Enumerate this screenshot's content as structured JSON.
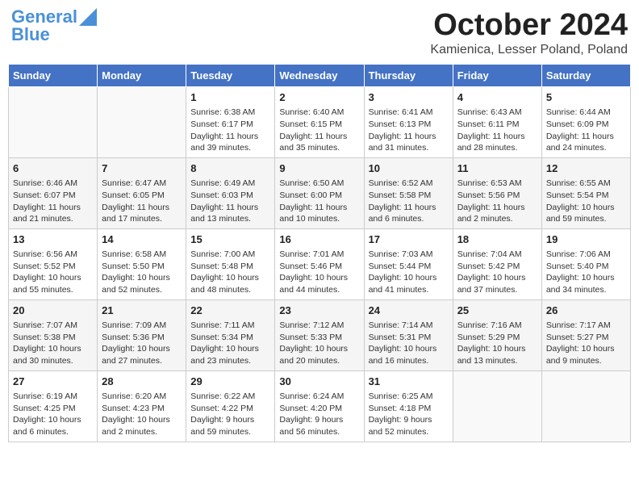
{
  "header": {
    "logo_line1": "General",
    "logo_line2": "Blue",
    "month": "October 2024",
    "location": "Kamienica, Lesser Poland, Poland"
  },
  "days_of_week": [
    "Sunday",
    "Monday",
    "Tuesday",
    "Wednesday",
    "Thursday",
    "Friday",
    "Saturday"
  ],
  "weeks": [
    [
      {
        "day": "",
        "detail": ""
      },
      {
        "day": "",
        "detail": ""
      },
      {
        "day": "1",
        "detail": "Sunrise: 6:38 AM\nSunset: 6:17 PM\nDaylight: 11 hours and 39 minutes."
      },
      {
        "day": "2",
        "detail": "Sunrise: 6:40 AM\nSunset: 6:15 PM\nDaylight: 11 hours and 35 minutes."
      },
      {
        "day": "3",
        "detail": "Sunrise: 6:41 AM\nSunset: 6:13 PM\nDaylight: 11 hours and 31 minutes."
      },
      {
        "day": "4",
        "detail": "Sunrise: 6:43 AM\nSunset: 6:11 PM\nDaylight: 11 hours and 28 minutes."
      },
      {
        "day": "5",
        "detail": "Sunrise: 6:44 AM\nSunset: 6:09 PM\nDaylight: 11 hours and 24 minutes."
      }
    ],
    [
      {
        "day": "6",
        "detail": "Sunrise: 6:46 AM\nSunset: 6:07 PM\nDaylight: 11 hours and 21 minutes."
      },
      {
        "day": "7",
        "detail": "Sunrise: 6:47 AM\nSunset: 6:05 PM\nDaylight: 11 hours and 17 minutes."
      },
      {
        "day": "8",
        "detail": "Sunrise: 6:49 AM\nSunset: 6:03 PM\nDaylight: 11 hours and 13 minutes."
      },
      {
        "day": "9",
        "detail": "Sunrise: 6:50 AM\nSunset: 6:00 PM\nDaylight: 11 hours and 10 minutes."
      },
      {
        "day": "10",
        "detail": "Sunrise: 6:52 AM\nSunset: 5:58 PM\nDaylight: 11 hours and 6 minutes."
      },
      {
        "day": "11",
        "detail": "Sunrise: 6:53 AM\nSunset: 5:56 PM\nDaylight: 11 hours and 2 minutes."
      },
      {
        "day": "12",
        "detail": "Sunrise: 6:55 AM\nSunset: 5:54 PM\nDaylight: 10 hours and 59 minutes."
      }
    ],
    [
      {
        "day": "13",
        "detail": "Sunrise: 6:56 AM\nSunset: 5:52 PM\nDaylight: 10 hours and 55 minutes."
      },
      {
        "day": "14",
        "detail": "Sunrise: 6:58 AM\nSunset: 5:50 PM\nDaylight: 10 hours and 52 minutes."
      },
      {
        "day": "15",
        "detail": "Sunrise: 7:00 AM\nSunset: 5:48 PM\nDaylight: 10 hours and 48 minutes."
      },
      {
        "day": "16",
        "detail": "Sunrise: 7:01 AM\nSunset: 5:46 PM\nDaylight: 10 hours and 44 minutes."
      },
      {
        "day": "17",
        "detail": "Sunrise: 7:03 AM\nSunset: 5:44 PM\nDaylight: 10 hours and 41 minutes."
      },
      {
        "day": "18",
        "detail": "Sunrise: 7:04 AM\nSunset: 5:42 PM\nDaylight: 10 hours and 37 minutes."
      },
      {
        "day": "19",
        "detail": "Sunrise: 7:06 AM\nSunset: 5:40 PM\nDaylight: 10 hours and 34 minutes."
      }
    ],
    [
      {
        "day": "20",
        "detail": "Sunrise: 7:07 AM\nSunset: 5:38 PM\nDaylight: 10 hours and 30 minutes."
      },
      {
        "day": "21",
        "detail": "Sunrise: 7:09 AM\nSunset: 5:36 PM\nDaylight: 10 hours and 27 minutes."
      },
      {
        "day": "22",
        "detail": "Sunrise: 7:11 AM\nSunset: 5:34 PM\nDaylight: 10 hours and 23 minutes."
      },
      {
        "day": "23",
        "detail": "Sunrise: 7:12 AM\nSunset: 5:33 PM\nDaylight: 10 hours and 20 minutes."
      },
      {
        "day": "24",
        "detail": "Sunrise: 7:14 AM\nSunset: 5:31 PM\nDaylight: 10 hours and 16 minutes."
      },
      {
        "day": "25",
        "detail": "Sunrise: 7:16 AM\nSunset: 5:29 PM\nDaylight: 10 hours and 13 minutes."
      },
      {
        "day": "26",
        "detail": "Sunrise: 7:17 AM\nSunset: 5:27 PM\nDaylight: 10 hours and 9 minutes."
      }
    ],
    [
      {
        "day": "27",
        "detail": "Sunrise: 6:19 AM\nSunset: 4:25 PM\nDaylight: 10 hours and 6 minutes."
      },
      {
        "day": "28",
        "detail": "Sunrise: 6:20 AM\nSunset: 4:23 PM\nDaylight: 10 hours and 2 minutes."
      },
      {
        "day": "29",
        "detail": "Sunrise: 6:22 AM\nSunset: 4:22 PM\nDaylight: 9 hours and 59 minutes."
      },
      {
        "day": "30",
        "detail": "Sunrise: 6:24 AM\nSunset: 4:20 PM\nDaylight: 9 hours and 56 minutes."
      },
      {
        "day": "31",
        "detail": "Sunrise: 6:25 AM\nSunset: 4:18 PM\nDaylight: 9 hours and 52 minutes."
      },
      {
        "day": "",
        "detail": ""
      },
      {
        "day": "",
        "detail": ""
      }
    ]
  ]
}
